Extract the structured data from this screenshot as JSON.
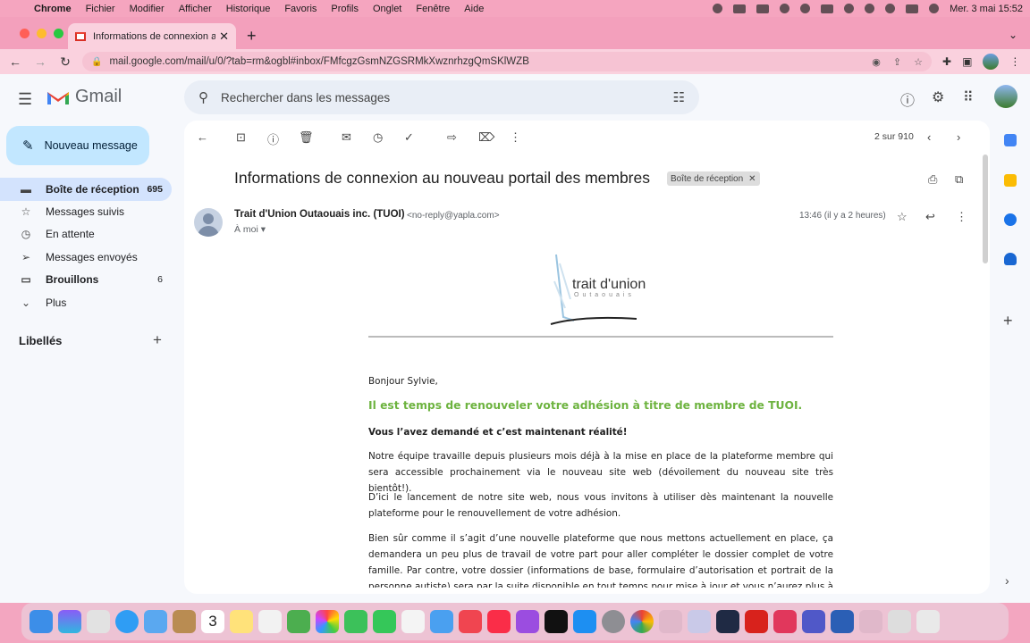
{
  "menubar": {
    "app": "Chrome",
    "items": [
      "Fichier",
      "Modifier",
      "Afficher",
      "Historique",
      "Favoris",
      "Profils",
      "Onglet",
      "Fenêtre",
      "Aide"
    ],
    "clock": "Mer. 3 mai  15:52"
  },
  "browser": {
    "tab_title": "Informations de connexion au n",
    "url": "mail.google.com/mail/u/0/?tab=rm&ogbl#inbox/FMfcgzGsmNZGSRMkXwznrhzgQmSKlWZB"
  },
  "gmail": {
    "logo_text": "Gmail",
    "compose_label": "Nouveau message",
    "search_placeholder": "Rechercher dans les messages",
    "nav": [
      {
        "label": "Boîte de réception",
        "count": "695",
        "icon": "inbox-icon"
      },
      {
        "label": "Messages suivis",
        "count": "",
        "icon": "star-icon"
      },
      {
        "label": "En attente",
        "count": "",
        "icon": "clock-icon"
      },
      {
        "label": "Messages envoyés",
        "count": "",
        "icon": "send-icon"
      },
      {
        "label": "Brouillons",
        "count": "6",
        "icon": "draft-icon"
      },
      {
        "label": "Plus",
        "count": "",
        "icon": "chevron-down-icon"
      }
    ],
    "labels_title": "Libellés",
    "pager": "2 sur 910"
  },
  "email": {
    "subject": "Informations de connexion au nouveau portail des membres",
    "chip": "Boîte de réception",
    "sender_name": "Trait d'Union Outaouais inc. (TUOI)",
    "sender_email": "<no-reply@yapla.com>",
    "to": "À moi",
    "time": "13:46 (il y a 2 heures)",
    "logo_brand": "trait d'union",
    "logo_sub": "Outaouais",
    "greeting": "Bonjour Sylvie,",
    "lead": "Il est temps de renouveler votre adhésion à titre de membre de TUOI.",
    "sublead": "Vous l’avez demandé et c’est maintenant réalité!",
    "p1": "Notre équipe travaille depuis plusieurs mois déjà à la mise en place de la plateforme membre qui sera accessible prochainement via le nouveau site web (dévoilement du nouveau site très bientôt!).",
    "p2": "D’ici le lancement de notre site web, nous vous invitons à utiliser dès maintenant la nouvelle plateforme pour le renouvellement de votre adhésion.",
    "p3": "Bien sûr comme il s’agit d’une nouvelle plateforme que nous mettons actuellement en place, ça demandera un peu plus de travail de votre part pour aller compléter le dossier complet de votre famille. Par contre, votre dossier (informations de base, formulaire d’autorisation et portrait de la personne autiste) sera par la suite disponible en tout temps pour mise à jour et vous n’aurez plus à les remplir au complet chaque année! Un"
  },
  "dock_calendar_day": "3",
  "colors": {
    "accent": "#6db33f",
    "menubar": "#f5a5bf",
    "active_nav": "#d3e3fd",
    "compose": "#c2e7ff"
  }
}
